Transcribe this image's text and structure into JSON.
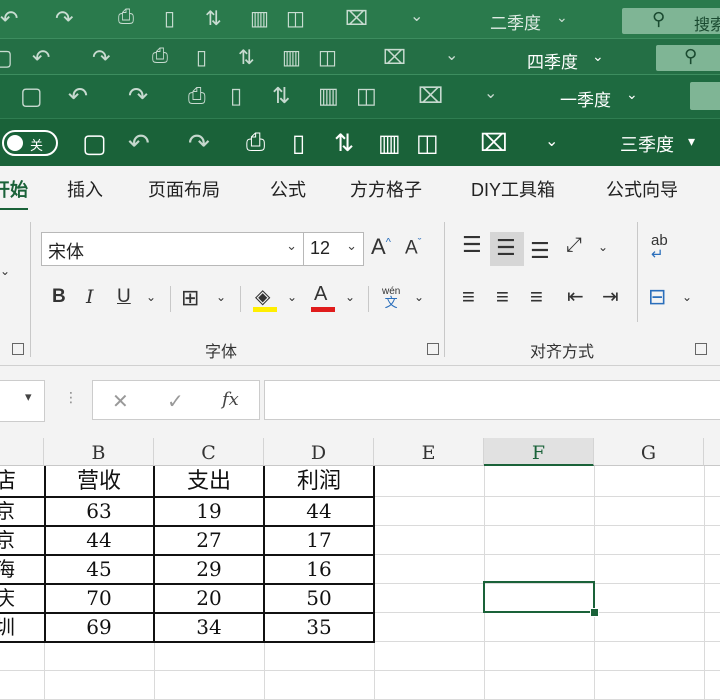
{
  "title_bars": [
    {
      "title": "二季度",
      "search_label": "搜索"
    },
    {
      "title": "四季度"
    },
    {
      "title": "一季度"
    },
    {
      "title": "三季度",
      "autosave_label": "关"
    }
  ],
  "tabs": [
    "开始",
    "插入",
    "页面布局",
    "公式",
    "方方格子",
    "DIY工具箱",
    "公式向导"
  ],
  "active_tab": "开始",
  "ribbon": {
    "font_name": "宋体",
    "font_size": "12",
    "bold_label": "B",
    "italic_label": "I",
    "underline_label": "U",
    "grow_font_label": "A",
    "shrink_font_label": "A",
    "font_color_label": "A",
    "phonetic_top": "wén",
    "phonetic_bottom": "文",
    "font_group_label": "字体",
    "align_group_label": "对齐方式",
    "wrap_label": "ab"
  },
  "formula_bar": {
    "fx_label": "fx",
    "cancel_symbol": "✕",
    "enter_symbol": "✓"
  },
  "grid": {
    "columns": [
      "B",
      "C",
      "D",
      "E",
      "F",
      "G"
    ],
    "selected_column": "F",
    "table_header": [
      "店",
      "营收",
      "支出",
      "利润"
    ],
    "rows": [
      [
        "京",
        "63",
        "19",
        "44"
      ],
      [
        "京",
        "44",
        "27",
        "17"
      ],
      [
        "海",
        "45",
        "29",
        "16"
      ],
      [
        "庆",
        "70",
        "20",
        "50"
      ],
      [
        "圳",
        "69",
        "34",
        "35"
      ]
    ]
  },
  "colors": {
    "brand": "#1a6239",
    "title_bar": "#1f6e43",
    "ribbon_bg": "#f3f3f3",
    "highlight": "#ffee00",
    "font_color": "#e01b1b"
  }
}
